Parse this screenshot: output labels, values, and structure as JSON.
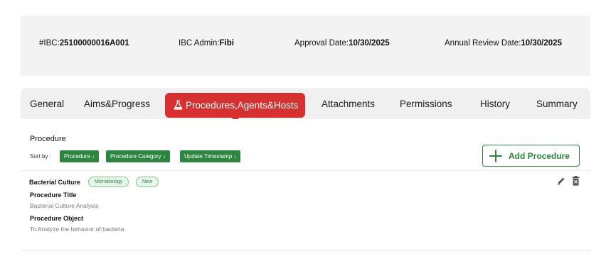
{
  "ibc_info": {
    "ibc_label": "#IBC:",
    "ibc_value": "25100000016A001",
    "admin_label": "IBC Admin:",
    "admin_value": "Fibi",
    "approval_label": "Approval Date:",
    "approval_value": "10/30/2025",
    "review_label": "Annual Review Date:",
    "review_value": "10/30/2025"
  },
  "tabs": [
    {
      "label": "General"
    },
    {
      "label": "Aims&Progress"
    },
    {
      "label": "Procedures,Agents&Hosts",
      "active": true,
      "icon": "flask-icon"
    },
    {
      "label": "Attachments"
    },
    {
      "label": "Permissions"
    },
    {
      "label": "History"
    },
    {
      "label": "Summary"
    }
  ],
  "procedure_section": {
    "title": "Procedure",
    "sort_label": "Sort by :",
    "sort_chips": [
      "Procedure ↓",
      "Procedure Category ↓",
      "Update Timestamp ↓"
    ],
    "add_button": "Add Procedure"
  },
  "procedure": {
    "name": "Bacterial Culture",
    "tags": [
      "Microbiology",
      "New"
    ],
    "title_label": "Procedure Title",
    "title_value": "Bacterial Culture Analysis",
    "object_label": "Procedure Object",
    "object_value": "To Analyze the behavior of bacteria"
  },
  "colors": {
    "active_tab": "#d63030",
    "accent_green": "#2e8540",
    "tag_border": "#7cc48b"
  }
}
